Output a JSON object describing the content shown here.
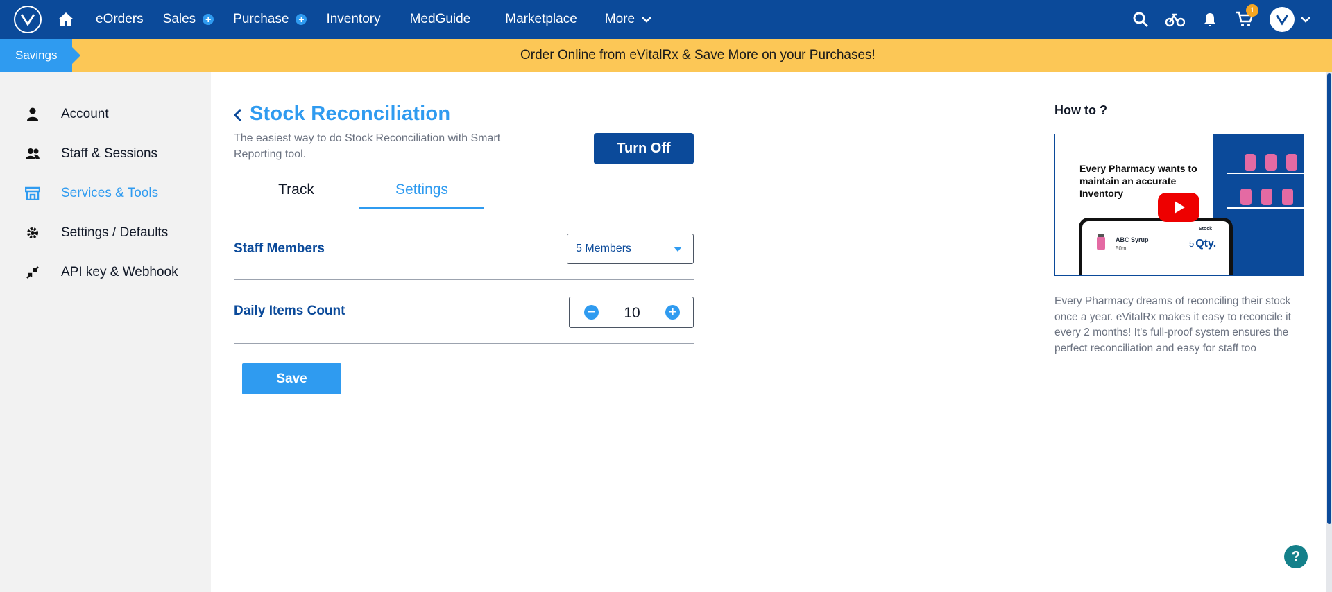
{
  "nav": {
    "logo_icon": "evitalrx-logo-icon",
    "home_icon": "home-icon",
    "items": [
      {
        "label": "eOrders"
      },
      {
        "label": "Sales",
        "badge": "+"
      },
      {
        "label": "Purchase",
        "badge": "+"
      },
      {
        "label": "Inventory"
      },
      {
        "label": "MedGuide"
      },
      {
        "label": "Marketplace"
      },
      {
        "label": "More"
      }
    ],
    "cart_badge": "1"
  },
  "banner": {
    "tag": "Savings",
    "link": "Order Online from eVitalRx & Save More on your Purchases!",
    "bg_color": "#fcc756"
  },
  "sidebar": {
    "items": [
      {
        "label": "Account",
        "icon": "person-icon"
      },
      {
        "label": "Staff & Sessions",
        "icon": "people-icon"
      },
      {
        "label": "Services & Tools",
        "icon": "store-icon",
        "active": true
      },
      {
        "label": "Settings / Defaults",
        "icon": "gear-icon"
      },
      {
        "label": "API key & Webhook",
        "icon": "arrows-collapse-icon"
      }
    ]
  },
  "main": {
    "title": "Stock Reconciliation",
    "subtitle": "The easiest way to do Stock Reconciliation with Smart Reporting tool.",
    "toggle_button": "Turn Off",
    "tabs": [
      {
        "label": "Track"
      },
      {
        "label": "Settings",
        "active": true
      }
    ],
    "staff_members_label": "Staff Members",
    "staff_members_value": "5 Members",
    "daily_items_label": "Daily Items Count",
    "daily_items_value": "10",
    "save_button": "Save"
  },
  "howto": {
    "title": "How to ?",
    "video_caption": "Every Pharmacy wants to maintain an accurate Inventory",
    "video_product": "ABC Syrup",
    "video_product_size": "50ml",
    "video_stock_label": "Stock",
    "video_stock_value": "5",
    "video_stock_unit": "Qty.",
    "description": "Every Pharmacy dreams of reconciling their stock once a year. eVitalRx makes it easy to reconcile it every 2 months! It's full-proof system ensures the perfect reconciliation and easy for staff too"
  },
  "help_label": "?",
  "colors": {
    "primary": "#0b4a9a",
    "accent": "#2f9bf0"
  }
}
